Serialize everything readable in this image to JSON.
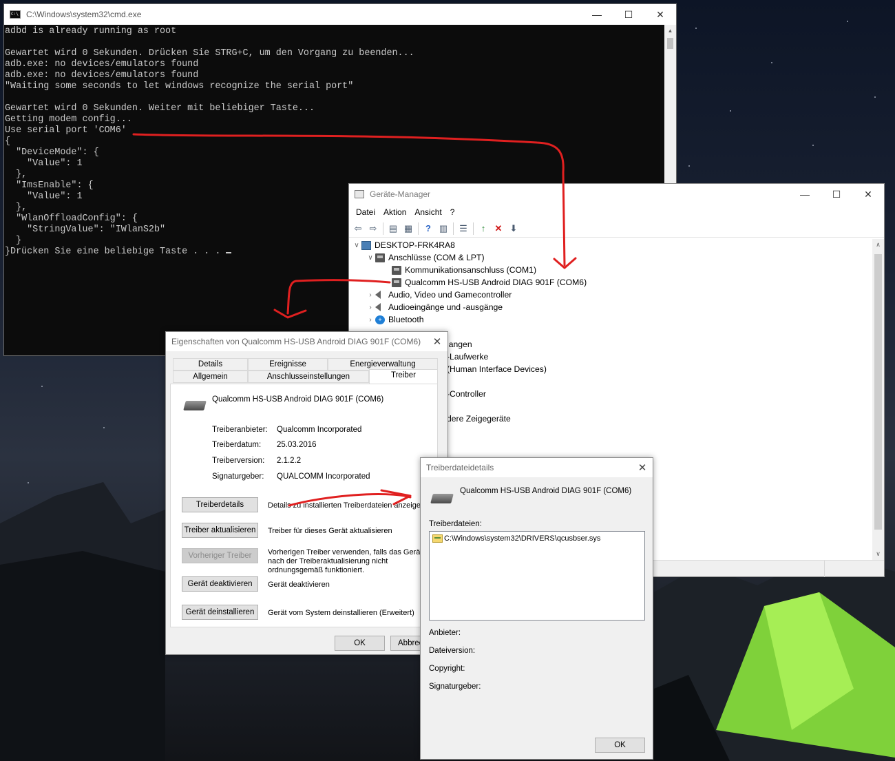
{
  "cmd": {
    "title": "C:\\Windows\\system32\\cmd.exe",
    "lines": [
      "adbd is already running as root",
      "",
      "Gewartet wird 0 Sekunden. Drücken Sie STRG+C, um den Vorgang zu beenden...",
      "adb.exe: no devices/emulators found",
      "adb.exe: no devices/emulators found",
      "\"Waiting some seconds to let windows recognize the serial port\"",
      "",
      "Gewartet wird 0 Sekunden. Weiter mit beliebiger Taste...",
      "Getting modem config...",
      "Use serial port 'COM6'",
      "{",
      "  \"DeviceMode\": {",
      "    \"Value\": 1",
      "  },",
      "  \"ImsEnable\": {",
      "    \"Value\": 1",
      "  },",
      "  \"WlanOffloadConfig\": {",
      "    \"StringValue\": \"IWlanS2b\"",
      "  }",
      "}Drücken Sie eine beliebige Taste . . . "
    ]
  },
  "devmgr": {
    "title": "Geräte-Manager",
    "menu": [
      "Datei",
      "Aktion",
      "Ansicht",
      "?"
    ],
    "tree": {
      "root": "DESKTOP-FRK4RA8",
      "ports_group": "Anschlüsse (COM & LPT)",
      "port_com1": "Kommunikationsanschluss (COM1)",
      "port_com6": "Qualcomm HS-USB Android DIAG 901F (COM6)",
      "audio_video": "Audio, Video und Gamecontroller",
      "audio_io": "Audioeingänge und -ausgänge",
      "bluetooth": "Bluetooth",
      "partial_1": "langen",
      "partial_2": "-Laufwerke",
      "partial_3": "(Human Interface Devices)",
      "partial_4": "-Controller",
      "partial_5": "dere Zeigegeräte"
    }
  },
  "props": {
    "title": "Eigenschaften von Qualcomm HS-USB Android DIAG 901F (COM6)",
    "tabs": {
      "details": "Details",
      "events": "Ereignisse",
      "power": "Energieverwaltung",
      "general": "Allgemein",
      "port_settings": "Anschlusseinstellungen",
      "driver": "Treiber"
    },
    "device_name": "Qualcomm HS-USB Android DIAG 901F (COM6)",
    "fields": {
      "provider_label": "Treiberanbieter:",
      "provider_value": "Qualcomm Incorporated",
      "date_label": "Treiberdatum:",
      "date_value": "25.03.2016",
      "version_label": "Treiberversion:",
      "version_value": "2.1.2.2",
      "signer_label": "Signaturgeber:",
      "signer_value": "QUALCOMM Incorporated"
    },
    "buttons": {
      "details": "Treiberdetails",
      "details_desc": "Details zu installierten Treiberdateien anzeigen",
      "update": "Treiber aktualisieren",
      "update_desc": "Treiber für dieses Gerät aktualisieren",
      "rollback": "Vorheriger Treiber",
      "rollback_desc": "Vorherigen Treiber verwenden, falls das Gerät nach der Treiberaktualisierung nicht ordnungsgemäß funktioniert.",
      "disable": "Gerät deaktivieren",
      "disable_desc": "Gerät deaktivieren",
      "uninstall": "Gerät deinstallieren",
      "uninstall_desc": "Gerät vom System deinstallieren (Erweitert)",
      "ok": "OK",
      "cancel": "Abbrech"
    }
  },
  "details": {
    "title": "Treiberdateidetails",
    "device_name": "Qualcomm HS-USB Android DIAG 901F (COM6)",
    "files_label": "Treiberdateien:",
    "files": [
      "C:\\Windows\\system32\\DRIVERS\\qcusbser.sys"
    ],
    "provider_label": "Anbieter:",
    "file_version_label": "Dateiversion:",
    "copyright_label": "Copyright:",
    "signer_label": "Signaturgeber:",
    "ok": "OK"
  },
  "colors": {
    "annotation": "#e02020",
    "cmd_bg": "#0c0c0c",
    "cmd_fg": "#cccccc"
  }
}
